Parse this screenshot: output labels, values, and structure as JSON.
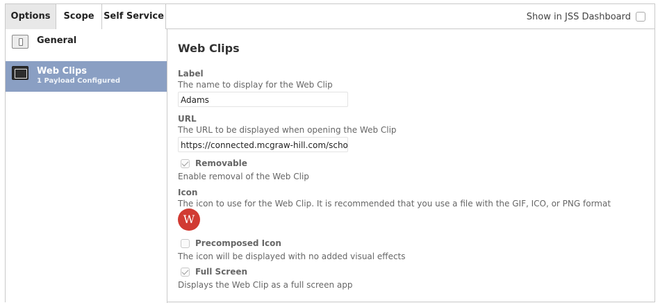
{
  "tabs": [
    {
      "label": "Options",
      "active": true
    },
    {
      "label": "Scope",
      "active": false
    },
    {
      "label": "Self Service",
      "active": false
    }
  ],
  "dashboard": {
    "label": "Show in JSS Dashboard",
    "checked": false
  },
  "sidebar": {
    "items": [
      {
        "title": "General",
        "subtitle": "",
        "icon": "general-icon",
        "selected": false
      },
      {
        "title": "Web Clips",
        "subtitle": "1 Payload Configured",
        "icon": "webclip-icon",
        "selected": true
      }
    ]
  },
  "main": {
    "heading": "Web Clips",
    "label_field": {
      "label": "Label",
      "description": "The name to display for the Web Clip",
      "value": "Adams"
    },
    "url_field": {
      "label": "URL",
      "description": "The URL to be displayed when opening the Web Clip",
      "value": "https://connected.mcgraw-hill.com/school"
    },
    "removable": {
      "label": "Removable",
      "description": "Enable removal of the Web Clip",
      "checked": true
    },
    "icon": {
      "label": "Icon",
      "description": "The icon to use for the Web Clip. It is recommended that you use a file with the GIF, ICO, or PNG format",
      "glyph": "W",
      "color": "#d13b33"
    },
    "precomposed": {
      "label": "Precomposed Icon",
      "description": "The icon will be displayed with no added visual effects",
      "checked": false
    },
    "fullscreen": {
      "label": "Full Screen",
      "description": "Displays the Web Clip as a full screen app",
      "checked": true
    }
  },
  "colors": {
    "selected_row": "#8a9fc3",
    "active_tab": "#e8e8e8",
    "border": "#c9c9c9"
  }
}
